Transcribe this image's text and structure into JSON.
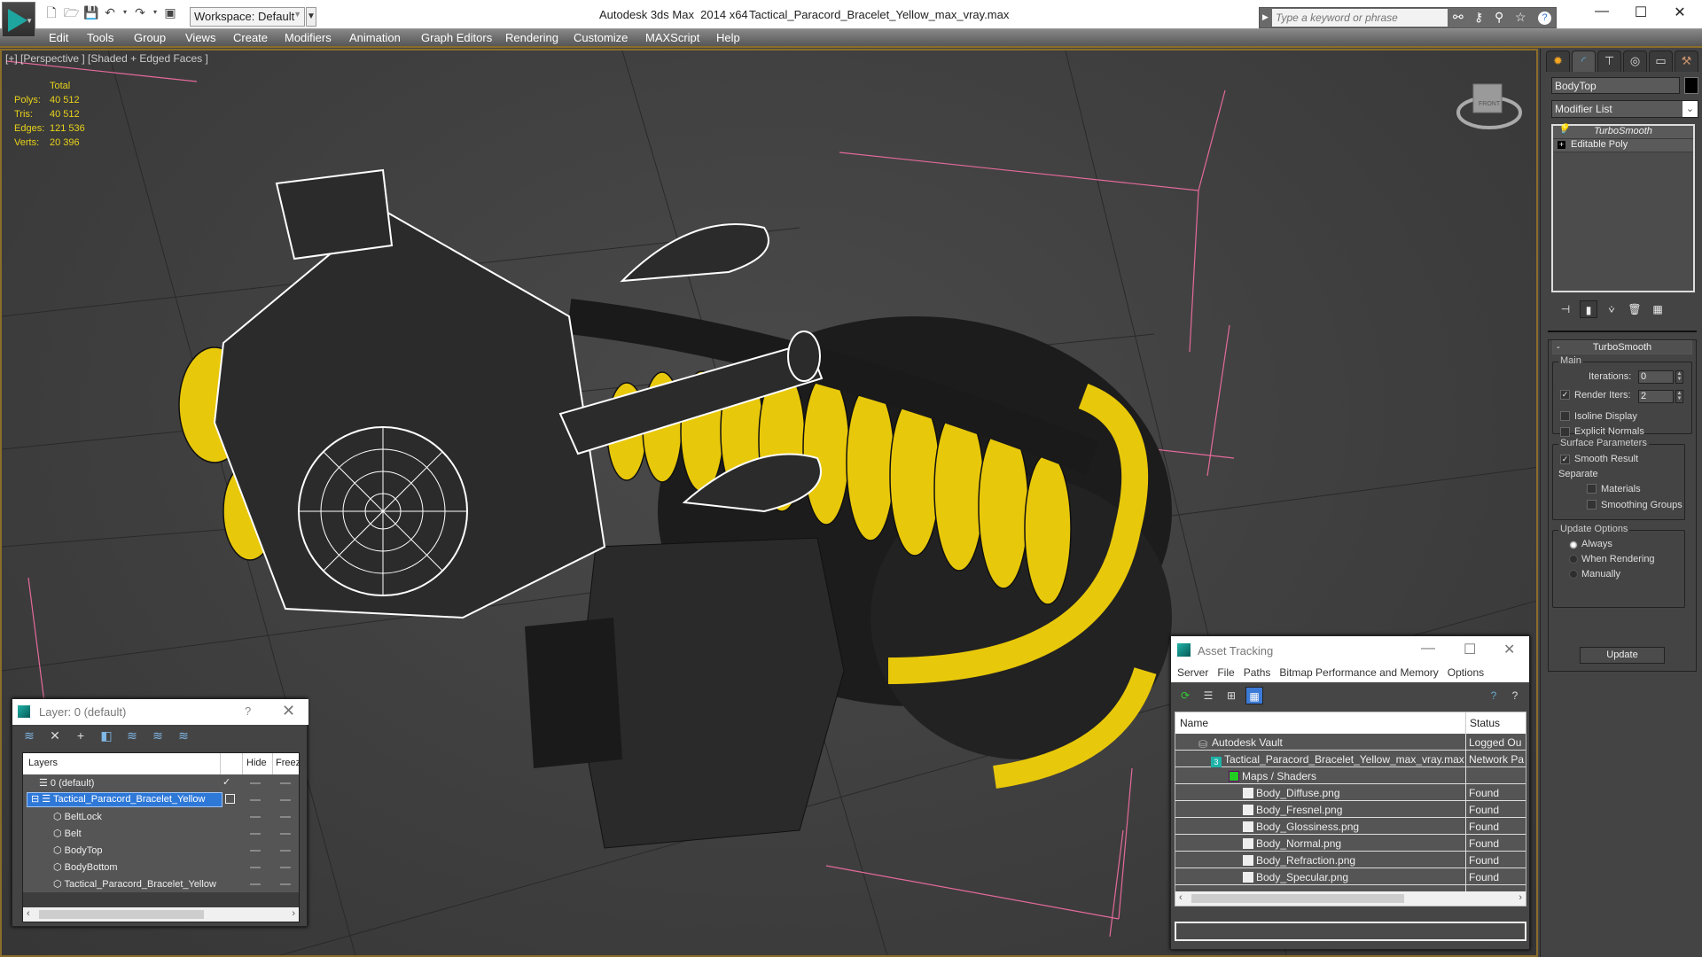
{
  "app": {
    "name": "Autodesk 3ds Max  2014 x64",
    "file": "Tactical_Paracord_Bracelet_Yellow_max_vray.max",
    "workspace": "Workspace: Default",
    "search_placeholder": "Type a keyword or phrase"
  },
  "menu": [
    "Edit",
    "Tools",
    "Group",
    "Views",
    "Create",
    "Modifiers",
    "Animation",
    "Graph Editors",
    "Rendering",
    "Customize",
    "MAXScript",
    "Help"
  ],
  "viewport": {
    "label": "[+] [Perspective ] [Shaded + Edged Faces ]",
    "stats": {
      "header": "Total",
      "rows": [
        {
          "k": "Polys:",
          "v": "40 512"
        },
        {
          "k": "Tris:",
          "v": "40 512"
        },
        {
          "k": "Edges:",
          "v": "121 536"
        },
        {
          "k": "Verts:",
          "v": "20 396"
        }
      ]
    },
    "viewcube_label": "FRONT",
    "colors": {
      "yellow": "#e8c80a",
      "black_cord": "#1c1c1c",
      "wire": "#ffffff",
      "grid_pink": "#e46a9a"
    }
  },
  "command_panel": {
    "object_name": "BodyTop",
    "modifier_list": "Modifier List",
    "stack": [
      "TurboSmooth",
      "Editable Poly"
    ],
    "rollout": {
      "title": "TurboSmooth",
      "main_label": "Main",
      "iterations_label": "Iterations:",
      "iterations": "0",
      "render_iters_label": "Render Iters:",
      "render_iters": "2",
      "render_iters_checked": true,
      "isoline_display": "Isoline Display",
      "explicit_normals": "Explicit Normals",
      "surface_params": "Surface Parameters",
      "smooth_result": "Smooth Result",
      "separate": "Separate",
      "materials": "Materials",
      "smoothing_groups": "Smoothing Groups",
      "update_options": "Update Options",
      "always": "Always",
      "when_rendering": "When Rendering",
      "manually": "Manually",
      "update_button": "Update"
    }
  },
  "layer_window": {
    "title": "Layer: 0 (default)",
    "help": "?",
    "columns": {
      "layers": "Layers",
      "hide": "Hide",
      "freeze": "Freez"
    },
    "rows": [
      {
        "name": "0 (default)",
        "type": "layer",
        "check": "✓"
      },
      {
        "name": "Tactical_Paracord_Bracelet_Yellow",
        "type": "layer",
        "selected": true
      },
      {
        "name": "BeltLock",
        "type": "object"
      },
      {
        "name": "Belt",
        "type": "object"
      },
      {
        "name": "BodyTop",
        "type": "object"
      },
      {
        "name": "BodyBottom",
        "type": "object"
      },
      {
        "name": "Tactical_Paracord_Bracelet_Yellow",
        "type": "object"
      }
    ]
  },
  "asset_tracking": {
    "title": "Asset Tracking",
    "menu": [
      "Server",
      "File",
      "Paths",
      "Bitmap Performance and Memory",
      "Options"
    ],
    "columns": {
      "name": "Name",
      "status": "Status"
    },
    "rows": [
      {
        "name": "Autodesk Vault",
        "status": "Logged Ou",
        "level": 1
      },
      {
        "name": "Tactical_Paracord_Bracelet_Yellow_max_vray.max",
        "status": "Network Pa",
        "level": 2
      },
      {
        "name": "Maps / Shaders",
        "status": "",
        "level": 3
      },
      {
        "name": "Body_Diffuse.png",
        "status": "Found",
        "level": 4
      },
      {
        "name": "Body_Fresnel.png",
        "status": "Found",
        "level": 4
      },
      {
        "name": "Body_Glossiness.png",
        "status": "Found",
        "level": 4
      },
      {
        "name": "Body_Normal.png",
        "status": "Found",
        "level": 4
      },
      {
        "name": "Body_Refraction.png",
        "status": "Found",
        "level": 4
      },
      {
        "name": "Body_Specular.png",
        "status": "Found",
        "level": 4
      }
    ]
  }
}
